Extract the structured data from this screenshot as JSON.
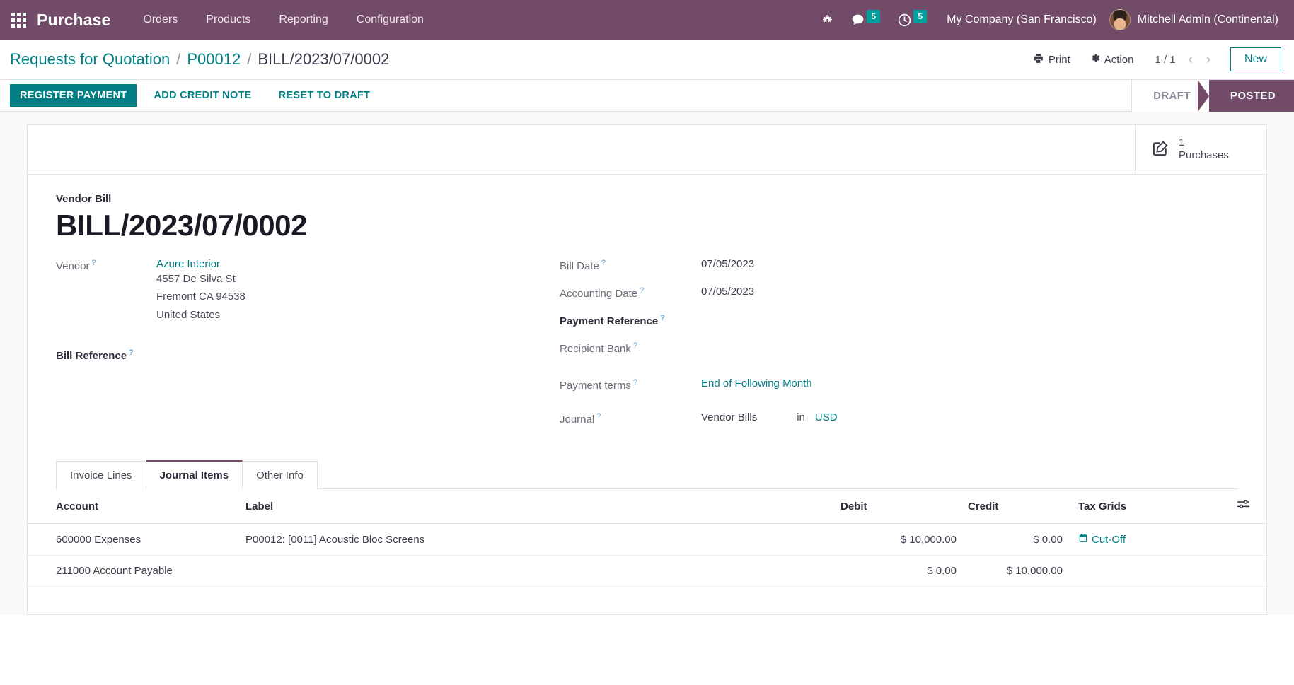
{
  "navbar": {
    "apps_icon": "apps-grid-icon",
    "brand": "Purchase",
    "menus": [
      "Orders",
      "Products",
      "Reporting",
      "Configuration"
    ],
    "debug_icon": "bug-icon",
    "messages_icon": "messages-icon",
    "messages_count": "5",
    "activities_icon": "clock-icon",
    "activities_count": "5",
    "company": "My Company (San Francisco)",
    "avatar_icon": "user-avatar",
    "user": "Mitchell Admin (Continental)"
  },
  "control_panel": {
    "breadcrumb": [
      {
        "label": "Requests for Quotation",
        "current": false
      },
      {
        "label": "P00012",
        "current": false
      },
      {
        "label": "BILL/2023/07/0002",
        "current": true
      }
    ],
    "separator": "/",
    "print_icon": "printer-icon",
    "print_label": "Print",
    "action_icon": "gear-icon",
    "action_label": "Action",
    "pager": "1 / 1",
    "prev_icon": "chevron-left-icon",
    "next_icon": "chevron-right-icon",
    "new_label": "New"
  },
  "statusbar": {
    "buttons": [
      {
        "label": "REGISTER PAYMENT",
        "primary": true
      },
      {
        "label": "ADD CREDIT NOTE",
        "primary": false
      },
      {
        "label": "RESET TO DRAFT",
        "primary": false
      }
    ],
    "states": [
      {
        "label": "DRAFT",
        "active": false
      },
      {
        "label": "POSTED",
        "active": true
      }
    ]
  },
  "smart_button": {
    "icon": "pencil-square-icon",
    "value": "1",
    "label": "Purchases"
  },
  "form": {
    "doc_kind": "Vendor Bill",
    "title": "BILL/2023/07/0002",
    "left": {
      "vendor_label": "Vendor",
      "vendor_value": "Azure Interior",
      "address": [
        "4557 De Silva St",
        "Fremont CA 94538",
        "United States"
      ],
      "bill_reference_label": "Bill Reference",
      "bill_reference_value": ""
    },
    "right": {
      "bill_date_label": "Bill Date",
      "bill_date_value": "07/05/2023",
      "accounting_date_label": "Accounting Date",
      "accounting_date_value": "07/05/2023",
      "payment_reference_label": "Payment Reference",
      "payment_reference_value": "",
      "recipient_bank_label": "Recipient Bank",
      "recipient_bank_value": "",
      "payment_terms_label": "Payment terms",
      "payment_terms_value": "End of Following Month",
      "journal_label": "Journal",
      "journal_value": "Vendor Bills",
      "journal_in": "in",
      "currency": "USD"
    },
    "help_marker": "?"
  },
  "tabs": [
    {
      "label": "Invoice Lines",
      "active": false
    },
    {
      "label": "Journal Items",
      "active": true
    },
    {
      "label": "Other Info",
      "active": false
    }
  ],
  "table": {
    "columns": [
      "Account",
      "Label",
      "Debit",
      "Credit",
      "Tax Grids"
    ],
    "optional_col_icon": "column-settings-icon",
    "rows": [
      {
        "account": "600000 Expenses",
        "label": "P00012: [0011] Acoustic Bloc Screens",
        "debit": "$ 10,000.00",
        "credit": "$ 0.00",
        "tax_grids": "Cut-Off",
        "tax_icon": "calendar-icon"
      },
      {
        "account": "211000 Account Payable",
        "label": "",
        "debit": "$ 0.00",
        "credit": "$ 10,000.00",
        "tax_grids": "",
        "tax_icon": ""
      }
    ]
  },
  "colors": {
    "brand_purple": "#714b67",
    "accent_teal": "#017e84",
    "badge_teal": "#00a09d"
  }
}
